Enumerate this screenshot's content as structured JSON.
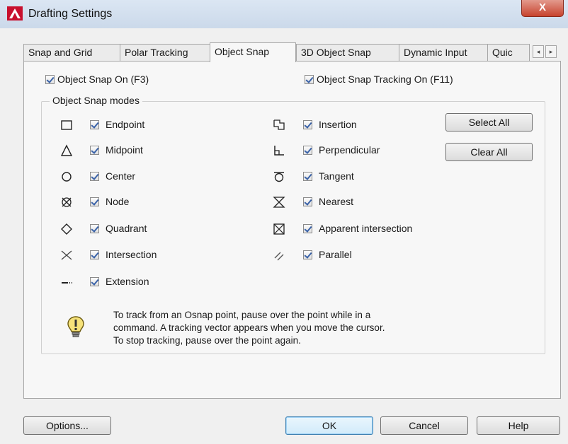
{
  "window": {
    "title": "Drafting Settings",
    "close_glyph": "X",
    "app_icon": "autocad-a-icon"
  },
  "tabs": [
    {
      "label": "Snap and Grid"
    },
    {
      "label": "Polar Tracking"
    },
    {
      "label": "Object Snap",
      "active": true
    },
    {
      "label": "3D Object Snap"
    },
    {
      "label": "Dynamic Input"
    },
    {
      "label": "Quic"
    }
  ],
  "tab_scroll": {
    "left": "◂",
    "right": "▸"
  },
  "toggles": {
    "osnap_on": {
      "label": "Object Snap On (F3)",
      "checked": true
    },
    "tracking_on": {
      "label": "Object Snap Tracking On (F11)",
      "checked": true
    }
  },
  "modes_group": {
    "title": "Object Snap modes"
  },
  "modes_left": [
    {
      "label": "Endpoint",
      "icon": "endpoint-square-icon",
      "checked": true
    },
    {
      "label": "Midpoint",
      "icon": "midpoint-triangle-icon",
      "checked": true
    },
    {
      "label": "Center",
      "icon": "center-circle-icon",
      "checked": true
    },
    {
      "label": "Node",
      "icon": "node-icon",
      "checked": true
    },
    {
      "label": "Quadrant",
      "icon": "quadrant-diamond-icon",
      "checked": true
    },
    {
      "label": "Intersection",
      "icon": "intersection-x-icon",
      "checked": true
    },
    {
      "label": "Extension",
      "icon": "extension-icon",
      "checked": true
    }
  ],
  "modes_right": [
    {
      "label": "Insertion",
      "icon": "insertion-icon",
      "checked": true
    },
    {
      "label": "Perpendicular",
      "icon": "perpendicular-icon",
      "checked": true
    },
    {
      "label": "Tangent",
      "icon": "tangent-icon",
      "checked": true
    },
    {
      "label": "Nearest",
      "icon": "nearest-hourglass-icon",
      "checked": true
    },
    {
      "label": "Apparent intersection",
      "icon": "apparent-intersection-icon",
      "checked": true
    },
    {
      "label": "Parallel",
      "icon": "parallel-icon",
      "checked": true
    }
  ],
  "side_buttons": {
    "select_all": "Select All",
    "clear_all": "Clear All"
  },
  "tip": {
    "icon": "lightbulb-icon",
    "lines": [
      "To track from an Osnap point, pause over the point while in a",
      "command.  A tracking vector appears when you move the cursor.",
      "To stop tracking, pause over the point again."
    ]
  },
  "footer": {
    "options": "Options...",
    "ok": "OK",
    "cancel": "Cancel",
    "help": "Help"
  }
}
